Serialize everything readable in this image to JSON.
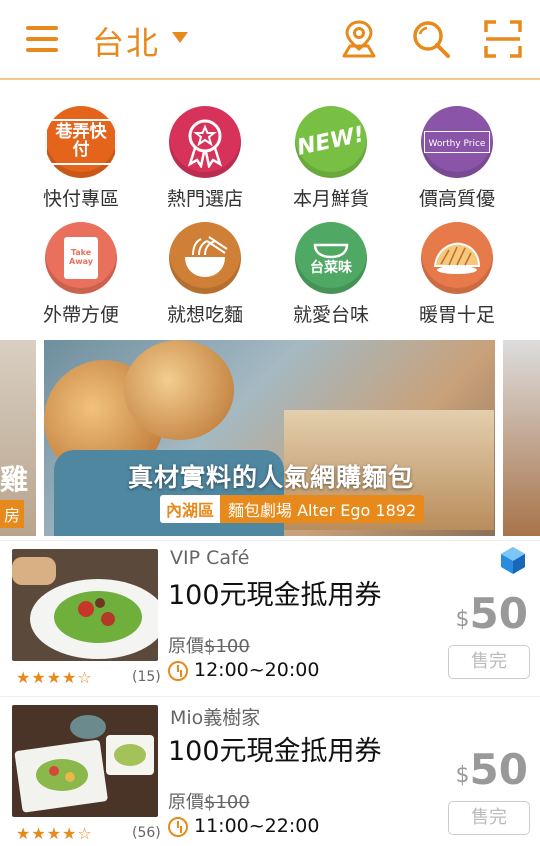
{
  "header": {
    "city": "台北",
    "icons": [
      "menu-icon",
      "location-pin-icon",
      "search-icon",
      "scan-icon"
    ]
  },
  "categories": [
    {
      "label": "快付專區",
      "icon_text": "巷弄快付",
      "icon": "quick-pay-icon",
      "color": "#e4641c"
    },
    {
      "label": "熱門選店",
      "icon_text": "",
      "icon": "award-ribbon-icon",
      "color": "#d7335a"
    },
    {
      "label": "本月鮮貨",
      "icon_text": "NEW!",
      "icon": "new-badge-icon",
      "color": "#78c044"
    },
    {
      "label": "價高質優",
      "icon_text": "Worthy Price",
      "icon": "worthy-price-icon",
      "color": "#8a54a8"
    },
    {
      "label": "外帶方便",
      "icon_text": "Take Away",
      "icon": "takeaway-bag-icon",
      "color": "#e8705c"
    },
    {
      "label": "就想吃麵",
      "icon_text": "",
      "icon": "noodle-bowl-icon",
      "color": "#cf8036"
    },
    {
      "label": "就愛台味",
      "icon_text": "台菜味",
      "icon": "taiwanese-food-icon",
      "color": "#4fa864"
    },
    {
      "label": "暖胃十足",
      "icon_text": "",
      "icon": "pastry-icon",
      "color": "#e67a4a"
    }
  ],
  "banner": {
    "left_peek_text": "雞",
    "left_peek_tag": "房",
    "headline": "真材實料的人氣網購麵包",
    "area": "內湖區",
    "shop": "麵包劇場 Alter Ego 1892"
  },
  "deals": [
    {
      "store": "VIP Café",
      "title": "100元現金抵用券",
      "orig_label": "原價",
      "orig_price": "$100",
      "time": "12:00~20:00",
      "price_currency": "$",
      "price": "50",
      "sold_out": "售完",
      "stars": "★★★★☆",
      "rating": 4,
      "review_count": "(15)"
    },
    {
      "store": "Mio義樹家",
      "title": "100元現金抵用券",
      "orig_label": "原價",
      "orig_price": "$100",
      "time": "11:00~22:00",
      "price_currency": "$",
      "price": "50",
      "sold_out": "售完",
      "stars": "★★★★☆",
      "rating": 4,
      "review_count": "(56)"
    }
  ],
  "colors": {
    "accent": "#e8891c",
    "sold_out_text": "#bbbbbb"
  }
}
